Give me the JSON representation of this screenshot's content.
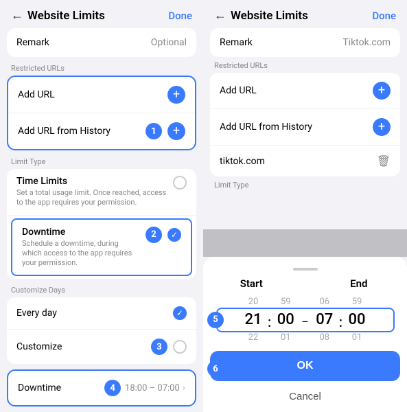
{
  "left": {
    "header": {
      "back_label": "←",
      "title": "Website Limits",
      "done_label": "Done"
    },
    "remark": {
      "label": "Remark",
      "placeholder": "Optional"
    },
    "restricted_urls": {
      "section_label": "Restricted URLs",
      "add_url": "Add URL",
      "add_url_history": "Add URL from History"
    },
    "limit_type": {
      "section_label": "Limit Type",
      "time_limits_label": "Time Limits",
      "time_limits_desc": "Set a total usage limit. Once reached, access to the app requires your permission.",
      "downtime_label": "Downtime",
      "downtime_desc": "Schedule a downtime, during which access to the app requires your permission."
    },
    "customize_days": {
      "section_label": "Customize Days",
      "every_day": "Every day",
      "customize": "Customize"
    },
    "downtime_row": {
      "label": "Downtime",
      "value": "18:00 – 07:00"
    },
    "steps": {
      "step1": "1",
      "step2": "2",
      "step3": "3",
      "step4": "4"
    }
  },
  "right": {
    "header": {
      "back_label": "←",
      "title": "Website Limits",
      "done_label": "Done"
    },
    "remark": {
      "label": "Remark",
      "value": "Tiktok.com"
    },
    "restricted_urls": {
      "section_label": "Restricted URLs",
      "add_url": "Add URL",
      "add_url_history": "Add URL from History",
      "url_item": "tiktok.com"
    },
    "limit_type": {
      "section_label": "Limit Type"
    },
    "time_picker": {
      "start_label": "Start",
      "end_label": "End",
      "start_hour_above": "20",
      "start_hour": "21",
      "start_hour_below": "22",
      "start_min_above": "59",
      "start_min": "00",
      "start_min_below": "01",
      "end_hour_above": "06",
      "end_hour": "07",
      "end_hour_below": "08",
      "end_min_above": "59",
      "end_min": "00",
      "end_min_below": "01",
      "ok_label": "OK",
      "cancel_label": "Cancel"
    },
    "steps": {
      "step5": "5",
      "step6": "6"
    }
  }
}
